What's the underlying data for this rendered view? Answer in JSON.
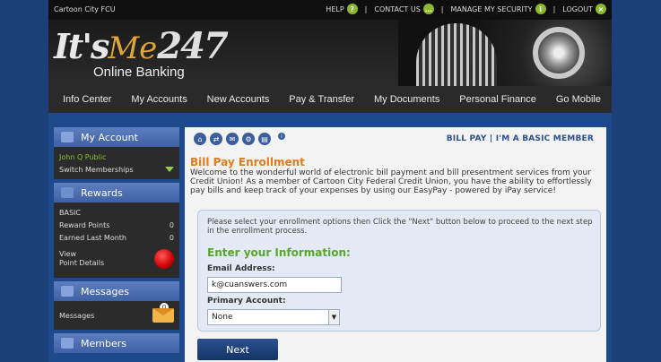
{
  "topbar": {
    "credit_union": "Cartoon City FCU",
    "links": [
      "HELP",
      "CONTACT US",
      "MANAGE MY SECURITY",
      "LOGOUT"
    ]
  },
  "logo": {
    "its": "It's",
    "me": "Me",
    "n247": "247",
    "sub": "Online Banking"
  },
  "nav": [
    "Info Center",
    "My Accounts",
    "New Accounts",
    "Pay & Transfer",
    "My Documents",
    "Personal Finance",
    "Go Mobile"
  ],
  "sidebar": {
    "my_account": "My Account",
    "user": "John Q Public",
    "switch": "Switch Memberships",
    "rewards": "Rewards",
    "level": "BASIC",
    "reward_points_label": "Reward Points",
    "reward_points_value": "0",
    "earned_label": "Earned Last Month",
    "earned_value": "0",
    "view_label": "View",
    "point_details": "Point Details",
    "messages_head": "Messages",
    "messages_label": "Messages",
    "messages_count": "0",
    "members_head": "Members"
  },
  "content": {
    "header_right": "BILL PAY | I'M A BASIC MEMBER",
    "heading": "Bill Pay Enrollment",
    "intro": "Welcome to the wonderful world of electronic bill payment and bill presentment services from your Credit Union! As a member of Cartoon City Federal Credit Union, you have the ability to effortlessly pay bills and keep track of your expenses by using our EasyPay - powered by iPay service!",
    "form_note": "Please select your enrollment options then Click the \"Next\" button below to proceed to the next step in the enrollment process.",
    "enter_info": "Enter your Information:",
    "email_label": "Email Address:",
    "email_value": "k@cuanswers.com",
    "account_label": "Primary Account:",
    "account_value": "None",
    "next": "Next"
  },
  "colors": {
    "heading_orange": "#e07b1a",
    "green_heading": "#5aa52e",
    "blue_bg": "#1e4a8c"
  }
}
